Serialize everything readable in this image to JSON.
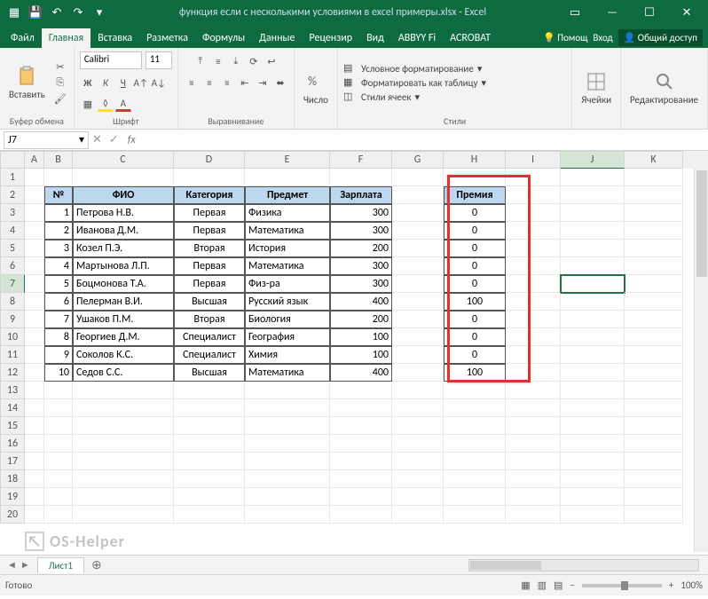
{
  "title": "функция если с несколькими условиями в excel примеры.xlsx - Excel",
  "tabs": {
    "file": "Файл",
    "list": [
      "Главная",
      "Вставка",
      "Разметка",
      "Формулы",
      "Данные",
      "Рецензир",
      "Вид",
      "ABBYY Fi",
      "ACROBAT"
    ],
    "help": "Помощ",
    "signin": "Вход",
    "share": "Общий доступ"
  },
  "ribbon": {
    "clipboard": {
      "label": "Буфер обмена",
      "paste": "Вставить"
    },
    "font": {
      "label": "Шрифт",
      "name": "Calibri",
      "size": "11"
    },
    "align": {
      "label": "Выравнивание"
    },
    "number": {
      "label": "Число",
      "btn": "Число"
    },
    "styles": {
      "label": "Стили",
      "cond": "Условное форматирование",
      "table": "Форматировать как таблицу",
      "cell": "Стили ячеек"
    },
    "cells": {
      "label": "Ячейки",
      "btn": "Ячейки"
    },
    "editing": {
      "label": "Редактирование",
      "btn": "Редактирование"
    }
  },
  "namebox": "J7",
  "formula": "",
  "columns": [
    "A",
    "B",
    "C",
    "D",
    "E",
    "F",
    "G",
    "H",
    "I",
    "J",
    "K"
  ],
  "headers": {
    "num": "№",
    "fio": "ФИО",
    "cat": "Категория",
    "subj": "Предмет",
    "sal": "Зарплата",
    "prem": "Премия"
  },
  "data": [
    {
      "n": "1",
      "fio": "Петрова Н.В.",
      "cat": "Первая",
      "subj": "Физика",
      "sal": "300",
      "prem": "0"
    },
    {
      "n": "2",
      "fio": "Иванова Д.М.",
      "cat": "Первая",
      "subj": "Математика",
      "sal": "300",
      "prem": "0"
    },
    {
      "n": "3",
      "fio": "Козел П.Э.",
      "cat": "Вторая",
      "subj": "История",
      "sal": "200",
      "prem": "0"
    },
    {
      "n": "4",
      "fio": "Мартынова Л.П.",
      "cat": "Первая",
      "subj": "Математика",
      "sal": "300",
      "prem": "0"
    },
    {
      "n": "5",
      "fio": "Боцмонова Т.А.",
      "cat": "Первая",
      "subj": "Физ-ра",
      "sal": "300",
      "prem": "0"
    },
    {
      "n": "6",
      "fio": "Пелерман В.И.",
      "cat": "Высшая",
      "subj": "Русский язык",
      "sal": "400",
      "prem": "100"
    },
    {
      "n": "7",
      "fio": "Ушаков П.М.",
      "cat": "Вторая",
      "subj": "Биология",
      "sal": "200",
      "prem": "0"
    },
    {
      "n": "8",
      "fio": "Георгиев Д.М.",
      "cat": "Специалист",
      "subj": "География",
      "sal": "100",
      "prem": "0"
    },
    {
      "n": "9",
      "fio": "Соколов К.С.",
      "cat": "Специалист",
      "subj": "Химия",
      "sal": "100",
      "prem": "0"
    },
    {
      "n": "10",
      "fio": "Седов С.С.",
      "cat": "Высшая",
      "subj": "Математика",
      "sal": "400",
      "prem": "100"
    }
  ],
  "sheet": {
    "name": "Лист1"
  },
  "status": {
    "ready": "Готово",
    "zoom": "100%"
  },
  "watermark": "OS-Helper"
}
